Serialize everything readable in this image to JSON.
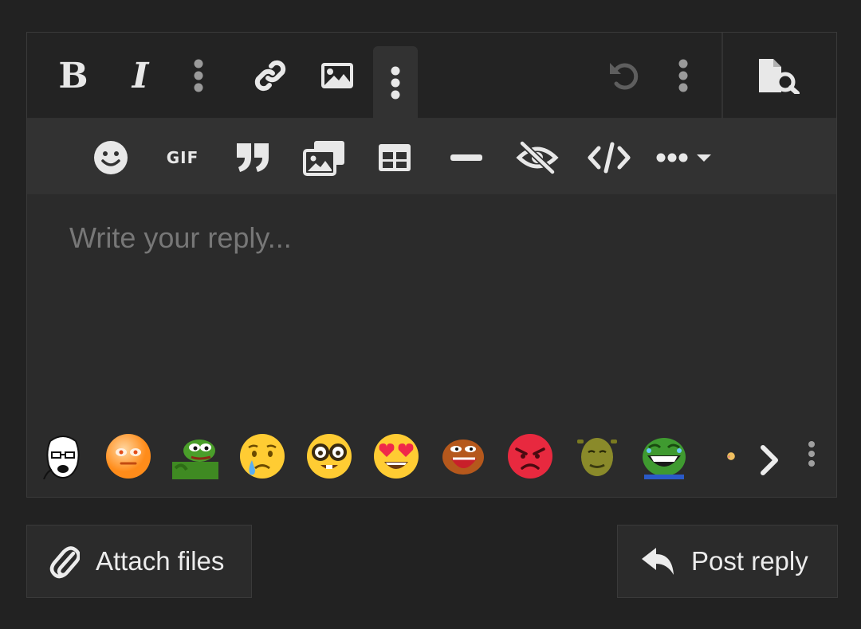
{
  "toolbar": {
    "bold": "B",
    "italic": "I",
    "gif": "GIF",
    "icons": [
      "bold-icon",
      "italic-icon",
      "more-text-icon",
      "link-icon",
      "image-icon",
      "more-insert-icon",
      "undo-icon",
      "more-options-icon",
      "preview-icon"
    ]
  },
  "subtoolbar": {
    "icons": [
      "smilie-icon",
      "gif-icon",
      "quote-icon",
      "media-icon",
      "table-icon",
      "horizontal-line-icon",
      "spoiler-icon",
      "code-icon",
      "more-dropdown-icon"
    ]
  },
  "editor": {
    "placeholder": "Write your reply..."
  },
  "smilies": {
    "items": [
      "wojak-smilie",
      "cursed-smilie",
      "pepe-smilie",
      "crying-smilie",
      "nerd-smilie",
      "heart-eyes-smilie",
      "angry-pepe-smilie",
      "rage-smilie",
      "shrek-smilie",
      "laughing-pepe-smilie",
      "blush-smilie"
    ]
  },
  "actions": {
    "attach_label": "Attach files",
    "post_label": "Post reply"
  },
  "colors": {
    "background": "#222222",
    "editor": "#2b2b2b",
    "icon": "#e8e8e8",
    "placeholder": "#777777"
  }
}
